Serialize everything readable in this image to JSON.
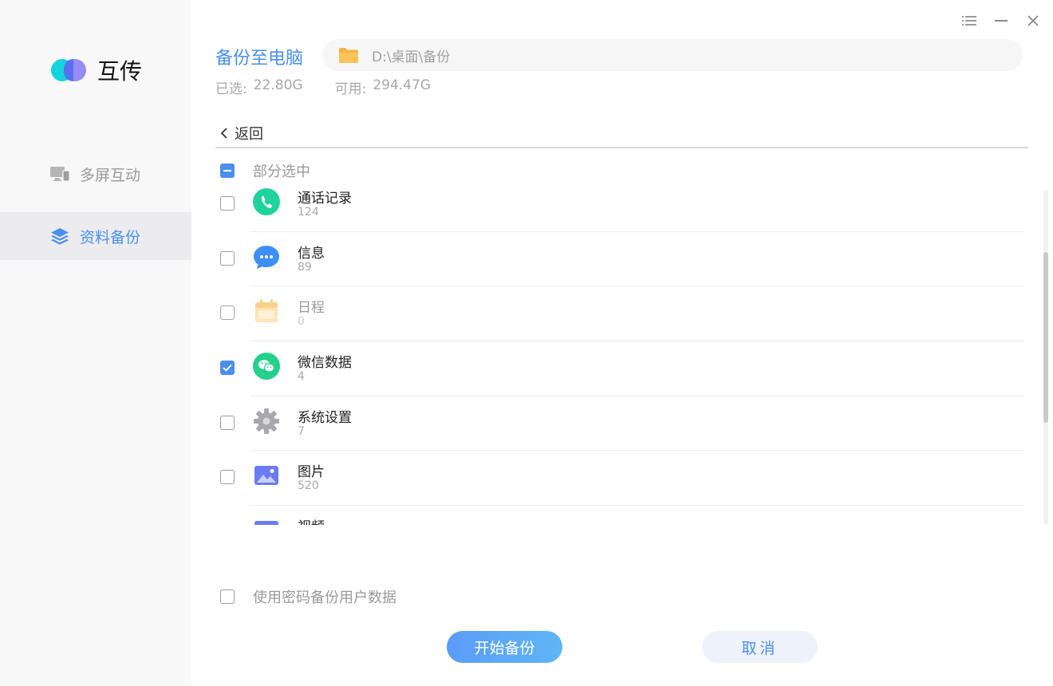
{
  "app": {
    "name": "互传"
  },
  "sidebar": {
    "items": [
      {
        "label": "多屏互动",
        "icon": "monitor-phone-icon",
        "active": false
      },
      {
        "label": "资料备份",
        "icon": "layers-icon",
        "active": true
      }
    ]
  },
  "window_controls": [
    "menu-icon",
    "minimize-icon",
    "close-icon"
  ],
  "header": {
    "title": "备份至电脑",
    "path": "D:\\桌面\\备份",
    "selected_label": "已选:",
    "selected_value": "22.80G",
    "available_label": "可用:",
    "available_value": "294.47G"
  },
  "back_label": "返回",
  "select_all": {
    "label": "部分选中",
    "state": "partial"
  },
  "items": [
    {
      "name": "通话记录",
      "count": "124",
      "checked": false,
      "icon": "phone-icon",
      "color": "#1fd39a"
    },
    {
      "name": "信息",
      "count": "89",
      "checked": false,
      "icon": "message-icon",
      "color": "#3d8ff5"
    },
    {
      "name": "日程",
      "count": "0",
      "checked": false,
      "icon": "calendar-icon",
      "color": "#f8c46b",
      "disabled": true
    },
    {
      "name": "微信数据",
      "count": "4",
      "checked": true,
      "icon": "wechat-icon",
      "color": "#24d08a"
    },
    {
      "name": "系统设置",
      "count": "7",
      "checked": false,
      "icon": "gear-icon",
      "color": "#a7a7ad"
    },
    {
      "name": "图片",
      "count": "520",
      "checked": false,
      "icon": "image-icon",
      "color": "#6b7cf3"
    },
    {
      "name": "视频",
      "count": "",
      "checked": false,
      "icon": "video-icon",
      "color": "#6b7cf3"
    }
  ],
  "password_option": {
    "label": "使用密码备份用户数据",
    "checked": false
  },
  "buttons": {
    "start": "开始备份",
    "cancel": "取消"
  },
  "colors": {
    "accent": "#4a8ff0"
  }
}
